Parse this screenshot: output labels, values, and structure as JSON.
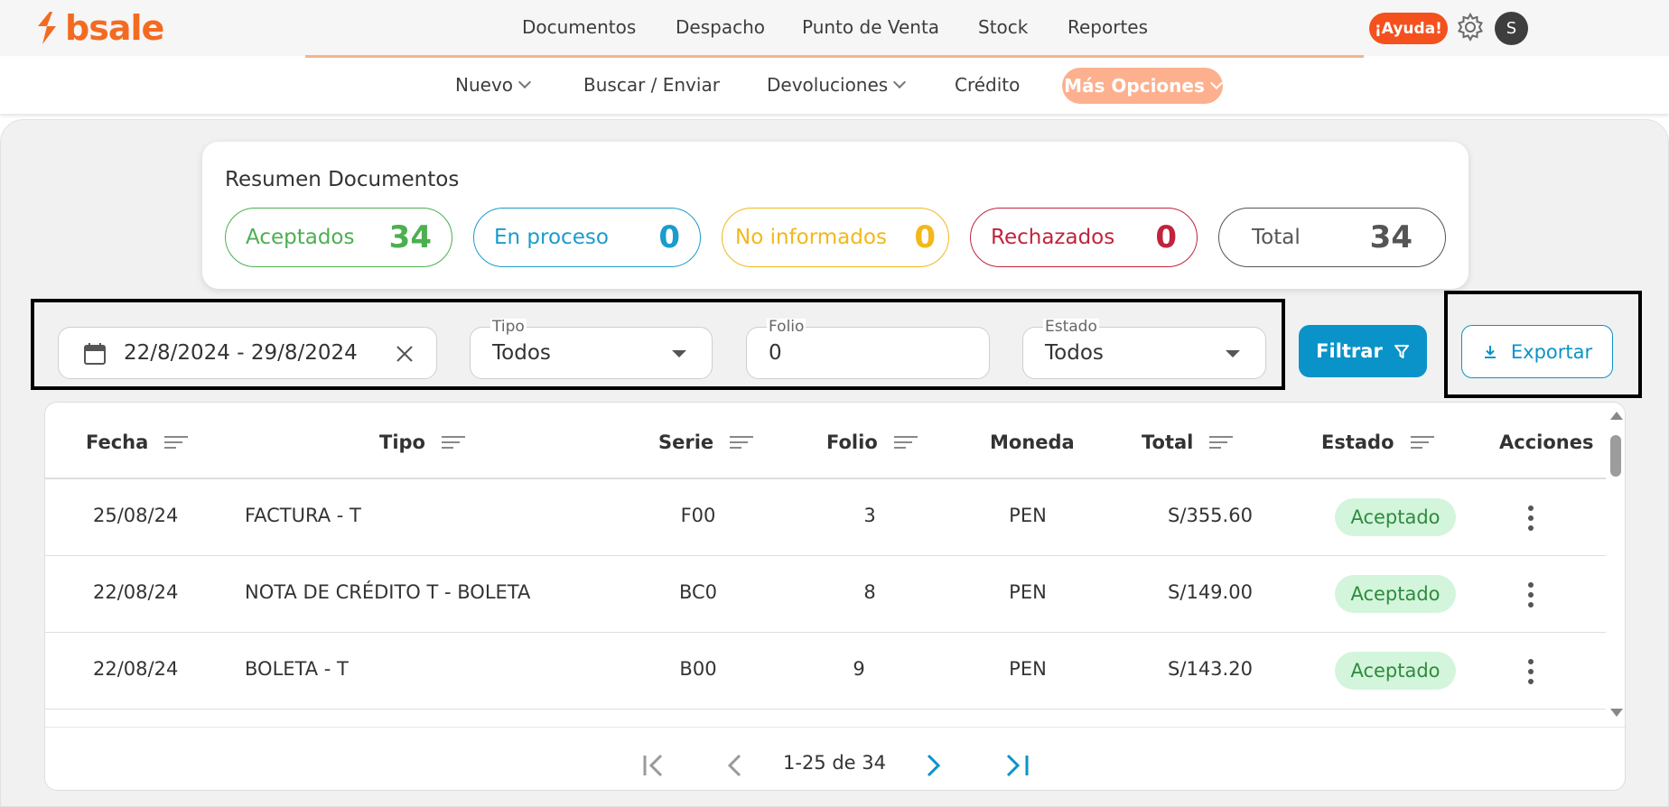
{
  "brand": {
    "name": "bsale",
    "color": "#f36b21"
  },
  "main_nav": [
    "Documentos",
    "Despacho",
    "Punto de Venta",
    "Stock",
    "Reportes"
  ],
  "header": {
    "help_label": "¡Ayuda!",
    "settings_icon": "gear-icon",
    "avatar_initial": "S"
  },
  "sub_nav": {
    "items": [
      "Nuevo",
      "Buscar / Enviar",
      "Devoluciones",
      "Crédito"
    ],
    "more_label": "Más Opciones"
  },
  "summary": {
    "title": "Resumen Documentos",
    "pills": [
      {
        "label": "Aceptados",
        "count": "34",
        "color": "#4caf50"
      },
      {
        "label": "En proceso",
        "count": "0",
        "color": "#1a9ccc"
      },
      {
        "label": "No informados",
        "count": "0",
        "color": "#f2b81a"
      },
      {
        "label": "Rechazados",
        "count": "0",
        "color": "#c0243c"
      },
      {
        "label": "Total",
        "count": "34",
        "color": "#555555"
      }
    ]
  },
  "filters": {
    "date_range": "22/8/2024 - 29/8/2024",
    "tipo": {
      "label": "Tipo",
      "value": "Todos"
    },
    "folio": {
      "label": "Folio",
      "value": "0"
    },
    "estado": {
      "label": "Estado",
      "value": "Todos"
    },
    "filter_button": "Filtrar",
    "export_button": "Exportar"
  },
  "table": {
    "columns": [
      "Fecha",
      "Tipo",
      "Serie",
      "Folio",
      "Moneda",
      "Total",
      "Estado",
      "Acciones"
    ],
    "rows": [
      {
        "fecha": "25/08/24",
        "tipo": "FACTURA - T",
        "serie": "F00",
        "folio": "3",
        "moneda": "PEN",
        "total": "S/355.60",
        "estado": "Aceptado"
      },
      {
        "fecha": "22/08/24",
        "tipo": "NOTA DE CRÉDITO T - BOLETA",
        "serie": "BC0",
        "folio": "8",
        "moneda": "PEN",
        "total": "S/149.00",
        "estado": "Aceptado"
      },
      {
        "fecha": "22/08/24",
        "tipo": "BOLETA - T",
        "serie": "B00",
        "folio": "9",
        "moneda": "PEN",
        "total": "S/143.20",
        "estado": "Aceptado"
      }
    ]
  },
  "pagination": {
    "label": "1-25 de 34"
  }
}
